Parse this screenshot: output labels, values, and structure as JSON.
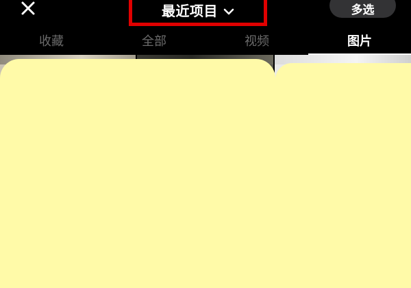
{
  "header": {
    "close_icon": "close-icon",
    "title": "最近项目",
    "title_dropdown_icon": "chevron-down-icon",
    "multi_select_label": "多选",
    "title_highlight_color": "#e00000"
  },
  "tabs": [
    {
      "label": "收藏",
      "active": false
    },
    {
      "label": "全部",
      "active": false
    },
    {
      "label": "视频",
      "active": false
    },
    {
      "label": "图片",
      "active": true
    }
  ],
  "colors": {
    "background": "#000000",
    "overlay": "#fffaa8",
    "tab_inactive": "#6b6b6b",
    "tab_active": "#ffffff",
    "pill": "#333335"
  }
}
